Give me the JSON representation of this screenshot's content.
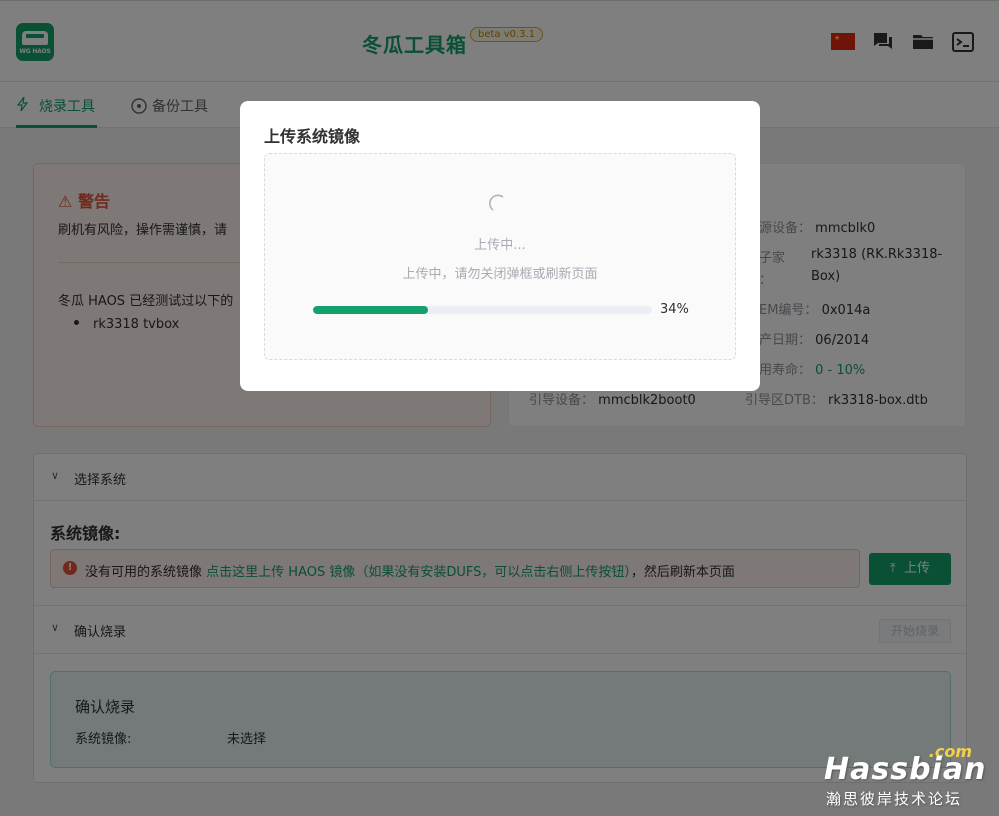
{
  "header": {
    "app_title": "冬瓜工具箱",
    "version_badge": "beta v0.3.1",
    "logo_text": "WG HAOS"
  },
  "tabs": [
    {
      "label": "烧录工具",
      "active": true
    },
    {
      "label": "备份工具",
      "active": false
    }
  ],
  "warning": {
    "title": "警告",
    "text": "刷机有风险，操作需谨慎，请",
    "tested_text": "冬瓜 HAOS 已经测试过以下的",
    "tested_items": [
      "rk3318 tvbox"
    ]
  },
  "device": {
    "source_key": "源设备：",
    "source_val": "mmcblk0",
    "family_key": "子家",
    "family_key2": "：",
    "family_val": "rk3318 (RK.Rk3318-",
    "family_val2": "Box)",
    "oem_key": "EM编号：",
    "oem_val": "0x014a",
    "date_key": "产日期：",
    "date_val": "06/2014",
    "life_key": "用寿命：",
    "life_val": "0 - 10%",
    "boot_key": "引导设备：",
    "boot_val": "mmcblk2boot0",
    "dtb_key": "引导区DTB：",
    "dtb_val": "rk3318-box.dtb"
  },
  "select_system": {
    "header": "选择系统",
    "system_image_label": "系统镜像:",
    "alert_prefix": "没有可用的系统镜像",
    "alert_link": "点击这里上传 HAOS 镜像（如果没有安装DUFS，可以点击右侧上传按钮）",
    "alert_suffix": "，然后刷新本页面",
    "upload_button": "上传"
  },
  "confirm": {
    "header": "确认烧录",
    "start_button": "开始烧录",
    "box_title": "确认烧录",
    "image_key": "系统镜像:",
    "image_val": "未选择"
  },
  "modal": {
    "title": "上传系统镜像",
    "status": "上传中...",
    "hint": "上传中，请勿关闭弹框或刷新页面",
    "progress": 34,
    "progress_label": "34%"
  },
  "watermark": {
    "com": ".com",
    "brand": "Hassbian",
    "sub": "瀚思彼岸技术论坛"
  },
  "colors": {
    "accent": "#13a06a",
    "danger": "#e0553b",
    "badge": "#d9a640"
  }
}
